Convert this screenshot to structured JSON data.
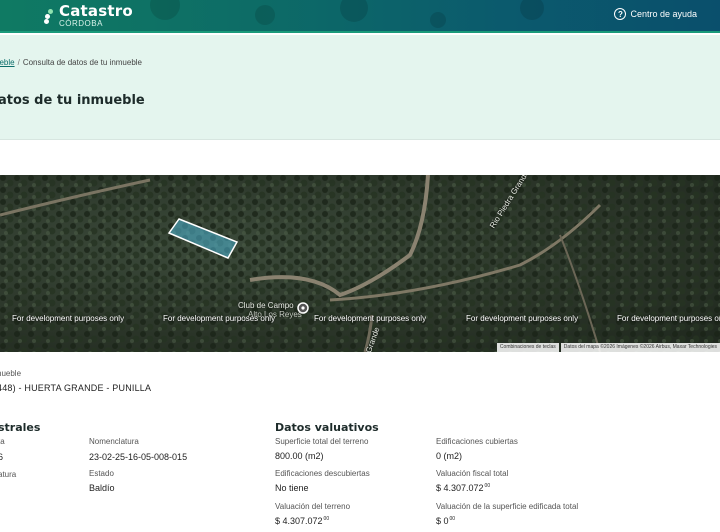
{
  "header": {
    "logo_title": "Catastro",
    "logo_subtitle": "CÓRDOBA",
    "help_icon": "question-circle-icon",
    "help_label": "Centro de ayuda"
  },
  "breadcrumb": {
    "link": "ueble",
    "separator": "/",
    "current": "Consulta de datos de tu inmueble"
  },
  "page_title": "atos de tu inmueble",
  "map": {
    "watermark": "For development purposes only",
    "labels": [
      "Club de Campo",
      "Alto Los Reyes",
      "Rio Piedra Grande",
      "Grande"
    ],
    "attribution": [
      "Combinaciones de teclas",
      "Datos del mapa ©2026 Imágenes ©2026 Airbus, Maxar Technologies"
    ],
    "colors": {
      "parcel_fill": "#4fb6d6",
      "parcel_stroke": "#ffffff"
    }
  },
  "location": {
    "label": "nueble",
    "value": "448) - HUERTA GRANDE - PUNILLA"
  },
  "catastrales": {
    "title": "strales",
    "rows": [
      {
        "label": "ta",
        "value": "6"
      },
      {
        "label": "atura",
        "value": ""
      }
    ],
    "nomenclatura_label": "Nomenclatura",
    "nomenclatura_value": "23-02-25-16-05-008-015",
    "estado_label": "Estado",
    "estado_value": "Baldío"
  },
  "valuativos": {
    "title": "Datos valuativos",
    "superficie_label": "Superficie total del terreno",
    "superficie_value": "800.00 (m2)",
    "edif_cubiertas_label": "Edificaciones cubiertas",
    "edif_cubiertas_value": "0 (m2)",
    "edif_descubiertas_label": "Edificaciones descubiertas",
    "edif_descubiertas_value": "No tiene",
    "val_fiscal_label": "Valuación fiscal total",
    "val_fiscal_value": "$ 4.307.072",
    "val_fiscal_cents": "00",
    "val_terreno_label": "Valuación del terreno",
    "val_terreno_value": "$ 4.307.072",
    "val_terreno_cents": "00",
    "val_edificada_label": "Valuación de la superficie edificada total",
    "val_edificada_value": "$ 0",
    "val_edificada_cents": "00"
  }
}
